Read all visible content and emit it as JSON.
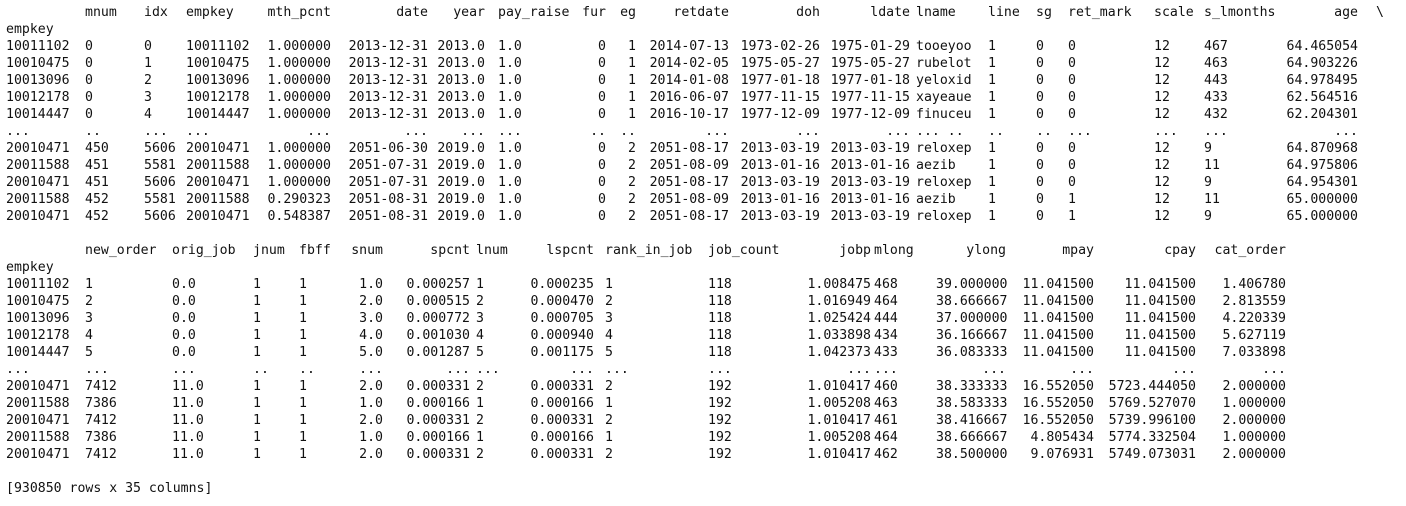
{
  "block1": {
    "header": [
      "mnum",
      "idx",
      "empkey",
      "mth_pcnt",
      "date",
      "year",
      "pay_raise",
      "fur",
      "eg",
      "retdate",
      "doh",
      "ldate",
      "lname",
      "line",
      "sg",
      "ret_mark",
      "scale",
      "s_lmonths",
      "age",
      "\\"
    ],
    "index_name": "empkey",
    "rows": [
      [
        "10011102",
        "0",
        "0",
        "10011102",
        "1.000000",
        "2013-12-31",
        "2013.0",
        "1.0",
        "0",
        "1",
        "2014-07-13",
        "1973-02-26",
        "1975-01-29",
        "tooeyoo",
        "1",
        "0",
        "0",
        "12",
        "467",
        "64.465054"
      ],
      [
        "10010475",
        "0",
        "1",
        "10010475",
        "1.000000",
        "2013-12-31",
        "2013.0",
        "1.0",
        "0",
        "1",
        "2014-02-05",
        "1975-05-27",
        "1975-05-27",
        "rubelot",
        "1",
        "0",
        "0",
        "12",
        "463",
        "64.903226"
      ],
      [
        "10013096",
        "0",
        "2",
        "10013096",
        "1.000000",
        "2013-12-31",
        "2013.0",
        "1.0",
        "0",
        "1",
        "2014-01-08",
        "1977-01-18",
        "1977-01-18",
        "yeloxid",
        "1",
        "0",
        "0",
        "12",
        "443",
        "64.978495"
      ],
      [
        "10012178",
        "0",
        "3",
        "10012178",
        "1.000000",
        "2013-12-31",
        "2013.0",
        "1.0",
        "0",
        "1",
        "2016-06-07",
        "1977-11-15",
        "1977-11-15",
        "xayeaue",
        "1",
        "0",
        "0",
        "12",
        "433",
        "62.564516"
      ],
      [
        "10014447",
        "0",
        "4",
        "10014447",
        "1.000000",
        "2013-12-31",
        "2013.0",
        "1.0",
        "0",
        "1",
        "2016-10-17",
        "1977-12-09",
        "1977-12-09",
        "finuceu",
        "1",
        "0",
        "0",
        "12",
        "432",
        "62.204301"
      ],
      [
        "...",
        "..",
        "...",
        "...",
        "...",
        "...",
        "...",
        "...",
        "..",
        "..",
        "...",
        "...",
        "...",
        "... ..",
        "..",
        "..",
        "...",
        "...",
        "...",
        "..."
      ],
      [
        "20010471",
        "450",
        "5606",
        "20010471",
        "1.000000",
        "2051-06-30",
        "2019.0",
        "1.0",
        "0",
        "2",
        "2051-08-17",
        "2013-03-19",
        "2013-03-19",
        "reloxep",
        "1",
        "0",
        "0",
        "12",
        "9",
        "64.870968"
      ],
      [
        "20011588",
        "451",
        "5581",
        "20011588",
        "1.000000",
        "2051-07-31",
        "2019.0",
        "1.0",
        "0",
        "2",
        "2051-08-09",
        "2013-01-16",
        "2013-01-16",
        "aezib",
        "1",
        "0",
        "0",
        "12",
        "11",
        "64.975806"
      ],
      [
        "20010471",
        "451",
        "5606",
        "20010471",
        "1.000000",
        "2051-07-31",
        "2019.0",
        "1.0",
        "0",
        "2",
        "2051-08-17",
        "2013-03-19",
        "2013-03-19",
        "reloxep",
        "1",
        "0",
        "0",
        "12",
        "9",
        "64.954301"
      ],
      [
        "20011588",
        "452",
        "5581",
        "20011588",
        "0.290323",
        "2051-08-31",
        "2019.0",
        "1.0",
        "0",
        "2",
        "2051-08-09",
        "2013-01-16",
        "2013-01-16",
        "aezib",
        "1",
        "0",
        "1",
        "12",
        "11",
        "65.000000"
      ],
      [
        "20010471",
        "452",
        "5606",
        "20010471",
        "0.548387",
        "2051-08-31",
        "2019.0",
        "1.0",
        "0",
        "2",
        "2051-08-17",
        "2013-03-19",
        "2013-03-19",
        "reloxep",
        "1",
        "0",
        "1",
        "12",
        "9",
        "65.000000"
      ]
    ]
  },
  "block2": {
    "header": [
      "new_order",
      "orig_job",
      "jnum",
      "fbff",
      "snum",
      "spcnt",
      "lnum",
      "lspcnt",
      "rank_in_job",
      "job_count",
      "jobp",
      "mlong",
      "ylong",
      "mpay",
      "cpay",
      "cat_order"
    ],
    "index_name": "empkey",
    "rows": [
      [
        "10011102",
        "1",
        "0.0",
        "1",
        "1",
        "1.0",
        "0.000257",
        "1",
        "0.000235",
        "1",
        "118",
        "1.008475",
        "468",
        "39.000000",
        "11.041500",
        "11.041500",
        "1.406780"
      ],
      [
        "10010475",
        "2",
        "0.0",
        "1",
        "1",
        "2.0",
        "0.000515",
        "2",
        "0.000470",
        "2",
        "118",
        "1.016949",
        "464",
        "38.666667",
        "11.041500",
        "11.041500",
        "2.813559"
      ],
      [
        "10013096",
        "3",
        "0.0",
        "1",
        "1",
        "3.0",
        "0.000772",
        "3",
        "0.000705",
        "3",
        "118",
        "1.025424",
        "444",
        "37.000000",
        "11.041500",
        "11.041500",
        "4.220339"
      ],
      [
        "10012178",
        "4",
        "0.0",
        "1",
        "1",
        "4.0",
        "0.001030",
        "4",
        "0.000940",
        "4",
        "118",
        "1.033898",
        "434",
        "36.166667",
        "11.041500",
        "11.041500",
        "5.627119"
      ],
      [
        "10014447",
        "5",
        "0.0",
        "1",
        "1",
        "5.0",
        "0.001287",
        "5",
        "0.001175",
        "5",
        "118",
        "1.042373",
        "433",
        "36.083333",
        "11.041500",
        "11.041500",
        "7.033898"
      ],
      [
        "...",
        "...",
        "...",
        "..",
        "..",
        "...",
        "...",
        "...",
        "...",
        "...",
        "...",
        "...",
        "...",
        "...",
        "...",
        "...",
        "..."
      ],
      [
        "20010471",
        "7412",
        "11.0",
        "1",
        "1",
        "2.0",
        "0.000331",
        "2",
        "0.000331",
        "2",
        "192",
        "1.010417",
        "460",
        "38.333333",
        "16.552050",
        "5723.444050",
        "2.000000"
      ],
      [
        "20011588",
        "7386",
        "11.0",
        "1",
        "1",
        "1.0",
        "0.000166",
        "1",
        "0.000166",
        "1",
        "192",
        "1.005208",
        "463",
        "38.583333",
        "16.552050",
        "5769.527070",
        "1.000000"
      ],
      [
        "20010471",
        "7412",
        "11.0",
        "1",
        "1",
        "2.0",
        "0.000331",
        "2",
        "0.000331",
        "2",
        "192",
        "1.010417",
        "461",
        "38.416667",
        "16.552050",
        "5739.996100",
        "2.000000"
      ],
      [
        "20011588",
        "7386",
        "11.0",
        "1",
        "1",
        "1.0",
        "0.000166",
        "1",
        "0.000166",
        "1",
        "192",
        "1.005208",
        "464",
        "38.666667",
        "4.805434",
        "5774.332504",
        "1.000000"
      ],
      [
        "20010471",
        "7412",
        "11.0",
        "1",
        "1",
        "2.0",
        "0.000331",
        "2",
        "0.000331",
        "2",
        "192",
        "1.010417",
        "462",
        "38.500000",
        "9.076931",
        "5749.073031",
        "2.000000"
      ]
    ]
  },
  "summary": "[930850 rows x 35 columns]"
}
